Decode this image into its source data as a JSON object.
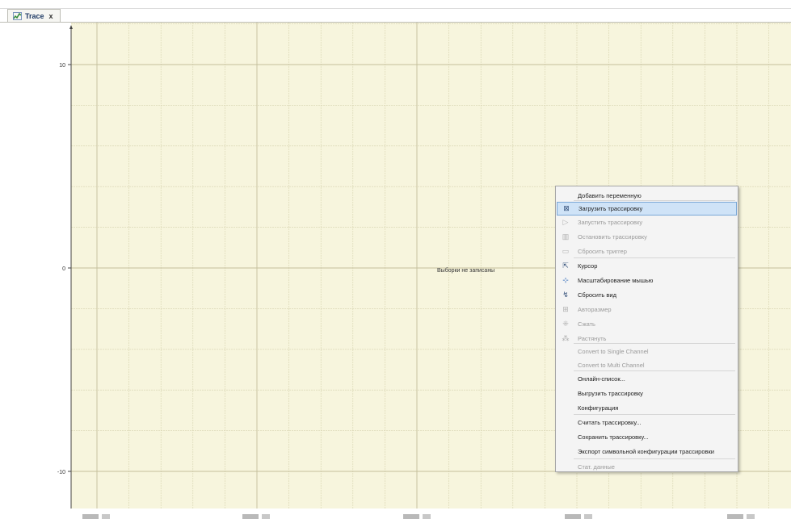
{
  "tab": {
    "title": "Trace",
    "close": "x",
    "icon": "trace-icon"
  },
  "plot": {
    "background": "#f7f5dd",
    "grid_color": "#d6d2ae",
    "major_grid_color": "#c4bf9b",
    "y_ticks": [
      "10",
      "0",
      "-10"
    ],
    "message": "Выборки не записаны"
  },
  "context_menu": {
    "items": [
      {
        "label": "Добавить переменную",
        "icon": "",
        "enabled": true
      },
      {
        "label": "Загрузить трассировку",
        "icon": "download-trace-icon",
        "enabled": true,
        "highlighted": true
      },
      {
        "label": "Запустить трассировку",
        "icon": "play-icon",
        "enabled": false
      },
      {
        "label": "Остановить трассировку",
        "icon": "stop-icon",
        "enabled": false
      },
      {
        "label": "Сбросить триггер",
        "icon": "reset-trigger-icon",
        "enabled": false
      },
      {
        "label": "Курсор",
        "icon": "cursor-icon",
        "enabled": true
      },
      {
        "label": "Масштабирование мышью",
        "icon": "mouse-zoom-icon",
        "enabled": true
      },
      {
        "label": "Сбросить вид",
        "icon": "reset-view-icon",
        "enabled": true
      },
      {
        "label": "Авторазмер",
        "icon": "autosize-icon",
        "enabled": false
      },
      {
        "label": "Сжать",
        "icon": "compress-icon",
        "enabled": false
      },
      {
        "label": "Растянуть",
        "icon": "stretch-icon",
        "enabled": false
      },
      {
        "label": "Convert to Single Channel",
        "icon": "",
        "enabled": false
      },
      {
        "label": "Convert to Multi Channel",
        "icon": "",
        "enabled": false
      },
      {
        "label": "Онлайн-список...",
        "icon": "",
        "enabled": true
      },
      {
        "label": "Выгрузить трассировку",
        "icon": "",
        "enabled": true
      },
      {
        "label": "Конфигурация",
        "icon": "",
        "enabled": true
      },
      {
        "label": "Считать трассировку...",
        "icon": "",
        "enabled": true
      },
      {
        "label": "Сохранить трассировку...",
        "icon": "",
        "enabled": true
      },
      {
        "label": "Экспорт символьной конфигурации трассировки",
        "icon": "",
        "enabled": true
      },
      {
        "label": "Стат. данные",
        "icon": "",
        "enabled": false
      }
    ]
  }
}
